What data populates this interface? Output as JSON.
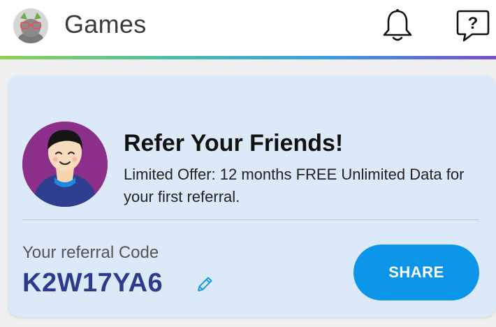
{
  "header": {
    "title": "Games",
    "avatar_icon": "profile-avatar-icon",
    "bell_icon": "bell-icon",
    "help_icon": "help-question-icon"
  },
  "colors": {
    "accent_blue": "#0b96ea",
    "code_color": "#2d3b8c",
    "card_bg": "#dbe9f8",
    "promo_avatar_bg": "#8b2f8a"
  },
  "referral": {
    "title": "Refer Your Friends!",
    "description": "Limited Offer: 12 months FREE Unlimited Data for your first referral.",
    "code_label": "Your referral Code",
    "code": "K2W17YA6",
    "edit_icon": "pencil-icon",
    "share_label": "SHARE"
  }
}
